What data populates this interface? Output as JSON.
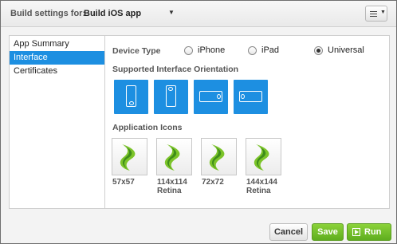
{
  "toolbar": {
    "label": "Build settings for:",
    "selected_build": "Build iOS app",
    "menu_icon": "hamburger-menu-icon"
  },
  "sidebar": {
    "items": [
      {
        "label": "App Summary",
        "selected": false
      },
      {
        "label": "Interface",
        "selected": true
      },
      {
        "label": "Certificates",
        "selected": false
      }
    ]
  },
  "device_type": {
    "label": "Device Type",
    "options": [
      {
        "label": "iPhone",
        "selected": false
      },
      {
        "label": "iPad",
        "selected": false
      },
      {
        "label": "Universal",
        "selected": true
      }
    ]
  },
  "orientation": {
    "label": "Supported Interface Orientation",
    "options": [
      {
        "icon": "phone-portrait-icon"
      },
      {
        "icon": "phone-portrait-upside-down-icon"
      },
      {
        "icon": "phone-landscape-left-icon"
      },
      {
        "icon": "phone-landscape-right-icon"
      }
    ],
    "accent_color": "#1d8fe1"
  },
  "app_icons": {
    "label": "Application Icons",
    "items": [
      {
        "line1": "57x57",
        "line2": ""
      },
      {
        "line1": "114x114",
        "line2": "Retina"
      },
      {
        "line1": "72x72",
        "line2": ""
      },
      {
        "line1": "144x144",
        "line2": "Retina"
      }
    ],
    "icon": "sencha-leaf-icon"
  },
  "footer": {
    "cancel_label": "Cancel",
    "save_label": "Save",
    "run_label": "Run",
    "primary_color": "#6abb27"
  }
}
